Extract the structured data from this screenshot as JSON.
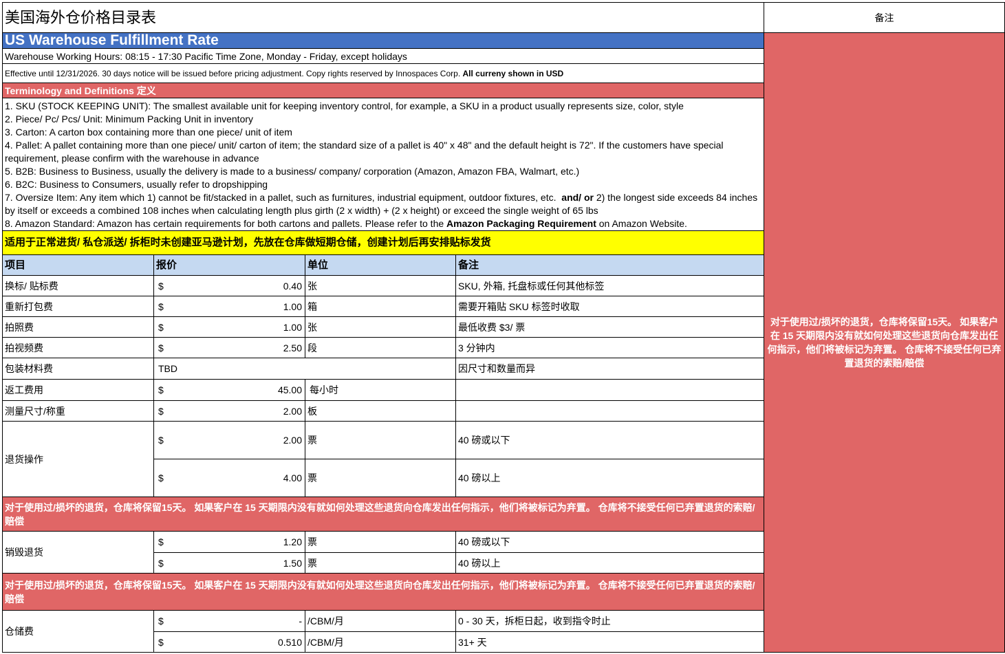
{
  "title": "美国海外仓价格目录表",
  "remarks_header": "备注",
  "section_title": "US Warehouse Fulfillment Rate",
  "working_hours": "Warehouse Working Hours: 08:15 - 17:30 Pacific Time Zone, Monday - Friday, except holidays",
  "effective_text": "Effective until 12/31/2026. 30 days notice will be issued before pricing adjustment. Copy rights reserved by Innospaces Corp.",
  "currency_note": "All curreny shown in USD",
  "terminology_header": "Terminology and Definitions 定义",
  "definitions": {
    "d1": "1. SKU (STOCK KEEPING UNIT): The smallest available unit for keeping inventory control, for example, a SKU in a product usually represents size, color, style",
    "d2": "2. Piece/ Pc/ Pcs/ Unit: Minimum Packing Unit in inventory",
    "d3": "3. Carton: A carton box containing more than one piece/ unit of item",
    "d4": "4. Pallet: A pallet containing more than one piece/ unit/ carton of item; the standard size of a pallet is 40\" x 48\" and the default height is 72\". If the customers have special requirement, please confirm with the warehouse in advance",
    "d5": "5. B2B: Business to Business, usually the delivery is made to a business/ company/ corporation (Amazon, Amazon FBA, Walmart, etc.)",
    "d6": "6. B2C: Business to Consumers, usually refer to dropshipping",
    "d7a": "7. Oversize Item: Any item which 1) cannot be fit/stacked in a pallet, such as furnitures, industrial equipment, outdoor fixtures, etc.",
    "d7b": "and/ or",
    "d7c": "2) the longest side exceeds 84 inches by itself or exceeds a combined 108 inches when calculating length plus girth (2 x width) + (2 x height) or exceed the single weight of 65 lbs",
    "d8a": "8. Amazon Standard: Amazon has certain requirements for both cartons and pallets. Please refer to the",
    "d8b": "Amazon Packaging Requirement",
    "d8c": "on Amazon Website."
  },
  "yellow_banner": "适用于正常进货/ 私仓派送/ 拆柜时未创建亚马逊计划，先放在仓库做短期仓储，创建计划后再安排贴标发货",
  "table_headers": {
    "item": "项目",
    "price": "报价",
    "unit": "单位",
    "note": "备注"
  },
  "currency_symbol": "$",
  "rows": {
    "r1": {
      "item": "换标/ 贴标费",
      "price": "0.40",
      "unit": "张",
      "note": "SKU, 外箱, 托盘标或任何其他标签"
    },
    "r2": {
      "item": "重新打包费",
      "price": "1.00",
      "unit": "箱",
      "note": "需要开箱贴 SKU 标签时收取"
    },
    "r3": {
      "item": "拍照费",
      "price": "1.00",
      "unit": "张",
      "note": "最低收费 $3/ 票"
    },
    "r4": {
      "item": "拍视频费",
      "price": "2.50",
      "unit": "段",
      "note": "3 分钟内"
    },
    "r5": {
      "item": "包装材料费",
      "price": "TBD",
      "unit": "",
      "note": "因尺寸和数量而异"
    },
    "r6": {
      "item": "返工费用",
      "price": "45.00",
      "unit": "每小时",
      "note": ""
    },
    "r7": {
      "item": "测量尺寸/称重",
      "price": "2.00",
      "unit": "板",
      "note": ""
    },
    "r8": {
      "item": "退货操作",
      "price_a": "2.00",
      "unit_a": "票",
      "note_a": "40 磅或以下",
      "price_b": "4.00",
      "unit_b": "票",
      "note_b": "40 磅以上"
    },
    "r9": {
      "item": "销毁退货",
      "price_a": "1.20",
      "unit_a": "票",
      "note_a": "40 磅或以下",
      "price_b": "1.50",
      "unit_b": "票",
      "note_b": "40 磅以上"
    },
    "r10": {
      "item": "仓储费",
      "price_a": "-",
      "unit_a": "/CBM/月",
      "note_a": "0 - 30 天，拆柜日起，收到指令时止",
      "price_b": "0.510",
      "unit_b": "/CBM/月",
      "note_b": "31+ 天"
    }
  },
  "return_notice": "对于使用过/损坏的退货，仓库将保留15天。 如果客户在 15 天期限内没有就如何处理这些退货向仓库发出任何指示，他们将被标记为弃置。 仓库将不接受任何已弃置退货的索赔/赔偿",
  "sidebar_notice": "对于使用过/损坏的退货，仓库将保留15天。 如果客户在 15 天期限内没有就如何处理这些退货向仓库发出任何指示，他们将被标记为弃置。 仓库将不接受任何已弃置退货的索赔/赔偿",
  "colors": {
    "blue_title": "#4472c4",
    "red_band": "#e06666",
    "yellow_banner": "#ffff00",
    "header_blue": "#c5d9f1"
  }
}
